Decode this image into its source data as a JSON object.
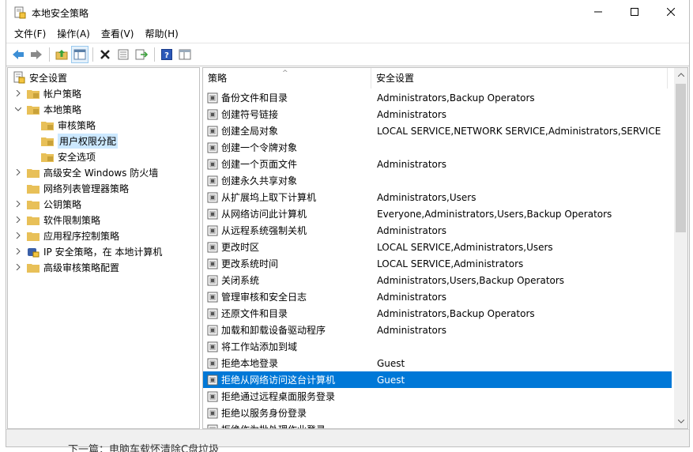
{
  "window": {
    "title": "本地安全策略"
  },
  "menu": [
    {
      "label": "文件(F)"
    },
    {
      "label": "操作(A)"
    },
    {
      "label": "查看(V)"
    },
    {
      "label": "帮助(H)"
    }
  ],
  "toolbar": [
    {
      "icon": "back-arrow-icon"
    },
    {
      "icon": "forward-arrow-icon"
    },
    {
      "icon": "up-folder-icon"
    },
    {
      "icon": "show-tree-icon"
    },
    {
      "icon": "delete-icon"
    },
    {
      "icon": "properties-icon"
    },
    {
      "icon": "export-list-icon"
    },
    {
      "icon": "help-icon"
    },
    {
      "icon": "console-view-icon"
    }
  ],
  "tree": {
    "root": "安全设置",
    "items": [
      {
        "label": "帐户策略",
        "level": 1,
        "expanded": false
      },
      {
        "label": "本地策略",
        "level": 1,
        "expanded": true
      },
      {
        "label": "审核策略",
        "level": 2
      },
      {
        "label": "用户权限分配",
        "level": 2,
        "selected": true
      },
      {
        "label": "安全选项",
        "level": 2
      },
      {
        "label": "高级安全 Windows 防火墙",
        "level": 1,
        "expanded": false
      },
      {
        "label": "网络列表管理器策略",
        "level": 1
      },
      {
        "label": "公钥策略",
        "level": 1,
        "expanded": false
      },
      {
        "label": "软件限制策略",
        "level": 1,
        "expanded": false
      },
      {
        "label": "应用程序控制策略",
        "level": 1,
        "expanded": false
      },
      {
        "label": "IP 安全策略，在 本地计算机",
        "level": 1,
        "expanded": false
      },
      {
        "label": "高级审核策略配置",
        "level": 1,
        "expanded": false
      }
    ]
  },
  "list": {
    "columns": [
      "策略",
      "安全设置"
    ],
    "rows": [
      {
        "policy": "备份文件和目录",
        "setting": "Administrators,Backup Operators"
      },
      {
        "policy": "创建符号链接",
        "setting": "Administrators"
      },
      {
        "policy": "创建全局对象",
        "setting": "LOCAL SERVICE,NETWORK SERVICE,Administrators,SERVICE"
      },
      {
        "policy": "创建一个令牌对象",
        "setting": ""
      },
      {
        "policy": "创建一个页面文件",
        "setting": "Administrators"
      },
      {
        "policy": "创建永久共享对象",
        "setting": ""
      },
      {
        "policy": "从扩展坞上取下计算机",
        "setting": "Administrators,Users"
      },
      {
        "policy": "从网络访问此计算机",
        "setting": "Everyone,Administrators,Users,Backup Operators"
      },
      {
        "policy": "从远程系统强制关机",
        "setting": "Administrators"
      },
      {
        "policy": "更改时区",
        "setting": "LOCAL SERVICE,Administrators,Users"
      },
      {
        "policy": "更改系统时间",
        "setting": "LOCAL SERVICE,Administrators"
      },
      {
        "policy": "关闭系统",
        "setting": "Administrators,Users,Backup Operators"
      },
      {
        "policy": "管理审核和安全日志",
        "setting": "Administrators"
      },
      {
        "policy": "还原文件和目录",
        "setting": "Administrators,Backup Operators"
      },
      {
        "policy": "加载和卸载设备驱动程序",
        "setting": "Administrators"
      },
      {
        "policy": "将工作站添加到域",
        "setting": ""
      },
      {
        "policy": "拒绝本地登录",
        "setting": "Guest"
      },
      {
        "policy": "拒绝从网络访问这台计算机",
        "setting": "Guest",
        "selected": true
      },
      {
        "policy": "拒绝通过远程桌面服务登录",
        "setting": ""
      },
      {
        "policy": "拒绝以服务身份登录",
        "setting": ""
      },
      {
        "policy": "拒绝作为批处理作业登录",
        "setting": ""
      }
    ]
  },
  "page_footer": "下一篇：电脑车载怀清除C盘垃圾",
  "colors": {
    "selection": "#0078d7",
    "tree_selection": "#cce8ff",
    "folder": "#e8c058"
  }
}
